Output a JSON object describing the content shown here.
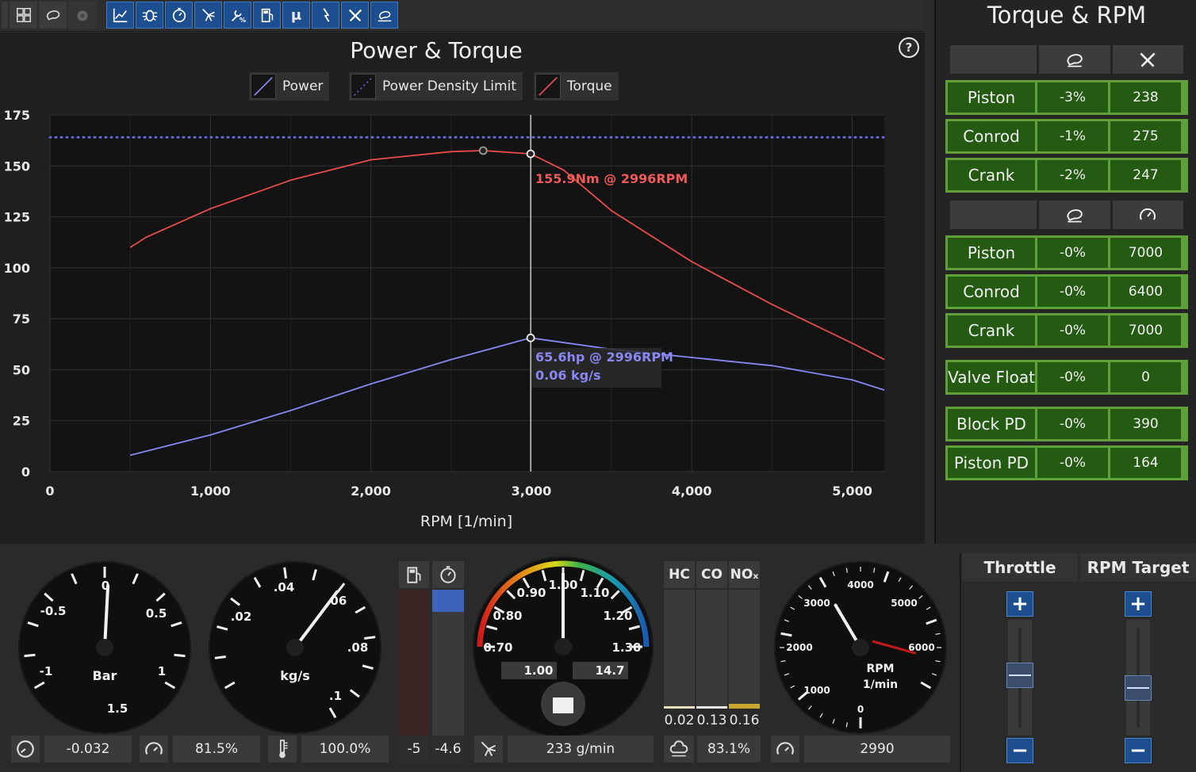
{
  "toolbar": {
    "group1": [
      "engine-layout-icon",
      "grid-icon",
      "turbo-icon",
      "turbine-icon"
    ],
    "group2": [
      "chart-icon",
      "bug-icon",
      "stopwatch-icon",
      "injector-icon",
      "wrench-percent-icon",
      "fuel-pump-icon",
      "mu-icon",
      "lightning-icon",
      "wrench-tools-icon",
      "bearing-icon"
    ],
    "mu_label": "μ"
  },
  "chart": {
    "title": "Power & Torque",
    "help_label": "?",
    "legend": [
      {
        "name": "Power",
        "color": "#8a86f2"
      },
      {
        "name": "Power Density Limit",
        "color": "#6a68d8"
      },
      {
        "name": "Torque",
        "color": "#e84c4c"
      }
    ],
    "torque_readout": "155.9Nm @ 2996RPM",
    "power_readout": "65.6hp @ 2996RPM",
    "flow_readout": "0.06 kg/s"
  },
  "chart_data": {
    "type": "line",
    "xlabel": "RPM [1/min]",
    "ylabel": "",
    "xlim": [
      0,
      5200
    ],
    "ylim": [
      0,
      175
    ],
    "x_ticks": [
      0,
      1000,
      2000,
      3000,
      4000,
      5000
    ],
    "x_tick_labels": [
      "0",
      "1,000",
      "2,000",
      "3,000",
      "4,000",
      "5,000"
    ],
    "y_ticks": [
      0,
      25,
      50,
      75,
      100,
      125,
      150,
      175
    ],
    "y_tick_labels": [
      "0",
      "25",
      "50",
      "75",
      "100",
      "125",
      "150",
      "175"
    ],
    "grid": true,
    "cursor_rpm": 2996,
    "series": [
      {
        "name": "Power",
        "color": "#8a86f2",
        "x": [
          500,
          1000,
          1500,
          2000,
          2500,
          2996,
          3500,
          4000,
          4500,
          5000,
          5200
        ],
        "y": [
          8,
          18,
          30,
          43,
          55,
          65.6,
          60,
          56,
          52,
          45,
          40
        ]
      },
      {
        "name": "Power Density Limit",
        "color": "#6a68d8",
        "dashed": true,
        "x": [
          0,
          5200
        ],
        "y": [
          164,
          164
        ]
      },
      {
        "name": "Torque",
        "color": "#e84c4c",
        "x": [
          500,
          600,
          1000,
          1500,
          2000,
          2500,
          2700,
          2996,
          3200,
          3500,
          4000,
          4500,
          5000,
          5200
        ],
        "y": [
          110,
          115,
          129,
          143,
          153,
          157,
          157.5,
          155.9,
          148,
          128,
          103,
          82,
          63,
          55
        ]
      }
    ],
    "markers": [
      {
        "series": "Torque",
        "x": 2700,
        "y": 157.5
      },
      {
        "series": "Torque",
        "x": 2996,
        "y": 155.9
      },
      {
        "series": "Power",
        "x": 2996,
        "y": 65.6
      }
    ]
  },
  "rightpanel": {
    "title": "Torque & RPM",
    "header1_icons": [
      "engine-icon",
      "wrench-tools-icon"
    ],
    "header2_icons": [
      "engine-icon",
      "tachometer-icon"
    ],
    "rows": [
      {
        "name": "Piston",
        "pct": "-3%",
        "val": "238"
      },
      {
        "name": "Conrod",
        "pct": "-1%",
        "val": "275"
      },
      {
        "name": "Crank",
        "pct": "-2%",
        "val": "247"
      },
      {
        "name": "Piston",
        "pct": "-0%",
        "val": "7000"
      },
      {
        "name": "Conrod",
        "pct": "-0%",
        "val": "6400"
      },
      {
        "name": "Crank",
        "pct": "-0%",
        "val": "7000"
      },
      {
        "name": "Valve Float",
        "pct": "-0%",
        "val": "0"
      },
      {
        "name": "Block PD",
        "pct": "-0%",
        "val": "390"
      },
      {
        "name": "Piston PD",
        "pct": "-0%",
        "val": "164"
      }
    ]
  },
  "gauges": {
    "boost": {
      "unit": "Bar",
      "labels": [
        "-1",
        "-0.5",
        "0",
        "0.5",
        "1",
        "1.5"
      ],
      "value": -0.032
    },
    "flow": {
      "unit": "kg/s",
      "labels": [
        ".02",
        ".04",
        ".06",
        ".08",
        ".1"
      ],
      "value": 0.06
    },
    "afr": {
      "labels": [
        "0.70",
        "0.80",
        "0.90",
        "1.00",
        "1.10",
        "1.20",
        "1.30"
      ],
      "lambda": "1.00",
      "afr": "14.7",
      "value": 1.0
    },
    "rpm": {
      "labels": [
        "0",
        "1000",
        "2000",
        "3000",
        "4000",
        "5000",
        "6000"
      ],
      "unit": "RPM",
      "unit2": "1/min",
      "value": 2990,
      "redline": 6000
    }
  },
  "bottom": {
    "boost_value": "-0.032",
    "efficiency_value": "81.5%",
    "temp_value": "100.0%",
    "fuel_left": "-5",
    "fuel_right": "-4.6",
    "fuel_flow": "233 g/min",
    "emissions_headers": [
      "HC",
      "CO",
      "NOₓ"
    ],
    "emissions_values": [
      "0.02",
      "0.13",
      "0.16"
    ],
    "emissions_pct": "83.1%",
    "rpm_value": "2990",
    "throttle_title": "Throttle",
    "rpm_target_title": "RPM Target",
    "plus": "+",
    "minus": "−",
    "throttle_level": 0.6,
    "rpm_target_level": 0.55
  }
}
